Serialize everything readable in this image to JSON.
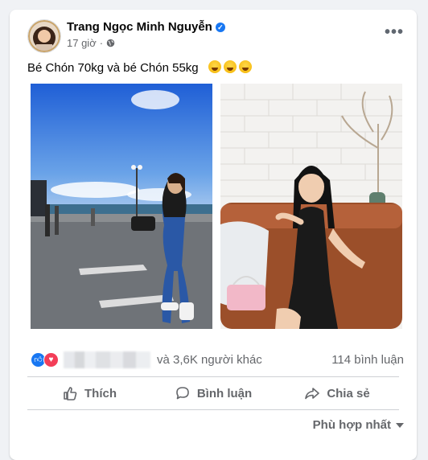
{
  "post": {
    "author": "Trang Ngọc Minh Nguyễn",
    "time": "17 giờ",
    "privacy_icon": "globe-icon",
    "text": "Bé Chón 70kg và bé Chón 55kg",
    "emojis": [
      "rolling-on-floor-laughing",
      "rolling-on-floor-laughing",
      "rolling-on-floor-laughing"
    ]
  },
  "stats": {
    "reactions": [
      "like",
      "love"
    ],
    "others_text": "và 3,6K người khác",
    "comments": "114 bình luận"
  },
  "actions": {
    "like": "Thích",
    "comment": "Bình luận",
    "share": "Chia sẻ"
  },
  "sort": {
    "label": "Phù hợp nhất"
  },
  "colors": {
    "accent": "#1877f2",
    "love": "#f33e58",
    "secondary_text": "#65676b"
  }
}
